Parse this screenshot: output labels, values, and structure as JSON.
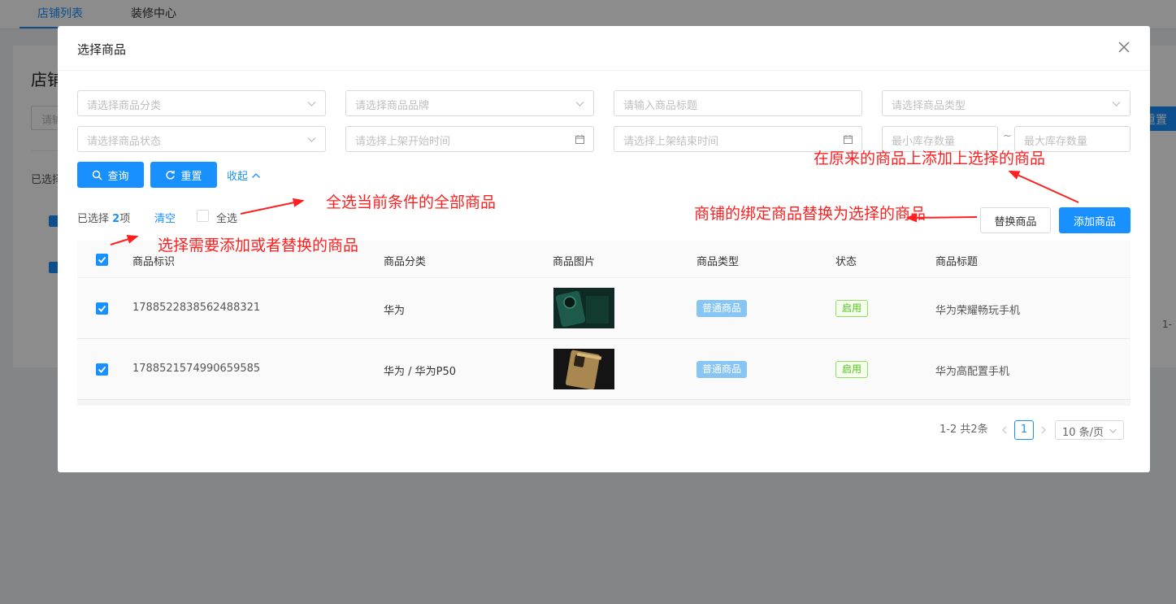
{
  "background": {
    "tabs": [
      "店铺列表",
      "装修中心"
    ],
    "title_fragment": "店铺",
    "input_fragment": "请输",
    "selected_fragment": "已选择",
    "right_button_fragment": "重置",
    "pager_fragment": "1-"
  },
  "modal": {
    "title": "选择商品",
    "filters": {
      "category": "请选择商品分类",
      "brand": "请选择商品品牌",
      "title": "请输入商品标题",
      "type": "请选择商品类型",
      "status": "请选择商品状态",
      "start_time": "请选择上架开始时间",
      "end_time": "请选择上架结束时间",
      "min_stock": "最小库存数量",
      "tilde": "~",
      "max_stock": "最大库存数量"
    },
    "actions": {
      "search": "查询",
      "reset": "重置",
      "collapse": "收起"
    },
    "selection": {
      "prefix": "已选择",
      "count": "2",
      "suffix": "项",
      "clear": "清空",
      "select_all": "全选"
    },
    "buttons": {
      "replace": "替换商品",
      "add": "添加商品"
    },
    "table": {
      "columns": [
        "商品标识",
        "商品分类",
        "商品图片",
        "商品类型",
        "状态",
        "商品标题"
      ],
      "rows": [
        {
          "id": "1788522838562488321",
          "category": "华为",
          "type": "普通商品",
          "status": "启用",
          "title": "华为荣耀畅玩手机"
        },
        {
          "id": "1788521574990659585",
          "category": "华为 / 华为P50",
          "type": "普通商品",
          "status": "启用",
          "title": "华为高配置手机"
        }
      ]
    },
    "pagination": {
      "summary": "1-2 共2条",
      "current": "1",
      "page_size": "10 条/页"
    }
  },
  "annotations": {
    "select_all": "全选当前条件的全部商品",
    "select_items": "选择需要添加或者替换的商品",
    "add": "在原来的商品上添加上选择的商品",
    "replace": "商铺的绑定商品替换为选择的商品"
  },
  "colors": {
    "primary": "#1890ff",
    "annotation": "#ff1f1f",
    "tag_blue": "#87c5f5",
    "tag_green": "#52c41a"
  }
}
